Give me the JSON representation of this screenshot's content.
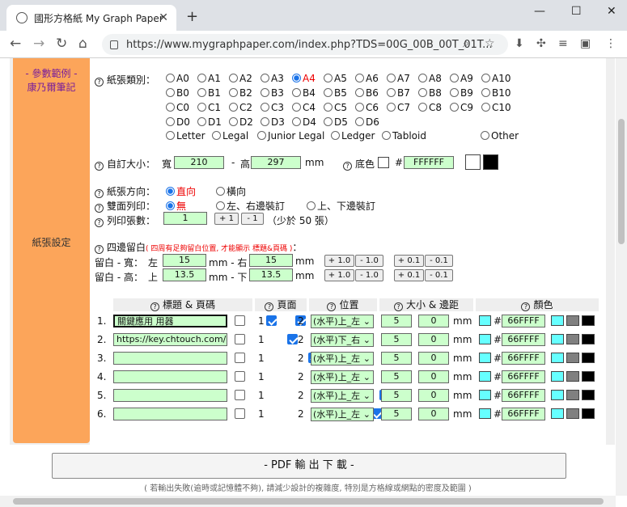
{
  "browser": {
    "tab_title": "國形方格紙 My Graph Paper",
    "url": "https://www.mygraphpaper.com/index.php?TDS=00G_00B_00T_01T...",
    "win_min": "—",
    "win_max": "☐",
    "win_close": "✕",
    "new_tab": "+",
    "tab_close": "✕",
    "back": "←",
    "forward": "→",
    "reload": "↻",
    "home": "⌂"
  },
  "sidebar": {
    "examples_label": "- 參數範例 -",
    "examples_link": "康乃爾筆記",
    "section_label": "紙張設定"
  },
  "paper_type": {
    "label": "紙張類別：",
    "row1": [
      "A0",
      "A1",
      "A2",
      "A3",
      "A4",
      "A5",
      "A6",
      "A7",
      "A8",
      "A9",
      "A10"
    ],
    "row2": [
      "B0",
      "B1",
      "B2",
      "B3",
      "B4",
      "B5",
      "B6",
      "B7",
      "B8",
      "B9",
      "B10"
    ],
    "row3": [
      "C0",
      "C1",
      "C2",
      "C3",
      "C4",
      "C5",
      "C6",
      "C7",
      "C8",
      "C9",
      "C10"
    ],
    "row4": [
      "D0",
      "D1",
      "D2",
      "D3",
      "D4",
      "D5",
      "D6"
    ],
    "row5": [
      "Letter",
      "Legal",
      "Junior Legal",
      "Ledger",
      "Tabloid"
    ],
    "other": "Other",
    "selected": "A4"
  },
  "custom_size": {
    "label": "自訂大小：",
    "width_label": "寬",
    "width_value": "210",
    "dash": "-",
    "height_label": "高",
    "height_value": "297",
    "unit": "mm",
    "bg_label": "底色",
    "hash": "#",
    "bg_value": "FFFFFF"
  },
  "orientation": {
    "label": "紙張方向：",
    "portrait": "直向",
    "landscape": "橫向"
  },
  "duplex": {
    "label": "雙面列印：",
    "none": "無",
    "lr": "左、右邊裝訂",
    "tb": "上、下邊裝訂"
  },
  "copies": {
    "label": "列印張數：",
    "value": "1",
    "plus": "+ 1",
    "minus": "- 1",
    "note": "（少於 50 張）"
  },
  "margins": {
    "label": "四邊留白",
    "note": "( 四周有足夠留白位置, 才能顯示 標題&頁碼 )",
    "colon": "：",
    "width_label": "留白 - 寬：",
    "left": "左",
    "left_value": "15",
    "mm_dash": "mm - 右",
    "right_value": "15",
    "unit": "mm",
    "height_label": "留白 - 高：",
    "top": "上",
    "top_value": "13.5",
    "mm_dash2": "mm - 下",
    "bottom_value": "13.5",
    "p10": "+ 1.0",
    "m10": "- 1.0",
    "p01": "+ 0.1",
    "m01": "- 0.1"
  },
  "header_table": {
    "col_title": "標題 & 頁碼",
    "col_page": "頁面",
    "col_pos": "位置",
    "col_size": "大小 & 邊距",
    "col_color": "顏色",
    "rows": [
      {
        "num": "1.",
        "text": "關鍵應用 用器",
        "pos": "(水平)上_左",
        "size": "5",
        "margin": "0",
        "color": "66FFFF"
      },
      {
        "num": "2.",
        "text": "https://key.chtouch.com/",
        "pos": "(水平)下_右",
        "size": "5",
        "margin": "0",
        "color": "66FFFF"
      },
      {
        "num": "3.",
        "text": "",
        "pos": "(水平)上_左",
        "size": "5",
        "margin": "0",
        "color": "66FFFF"
      },
      {
        "num": "4.",
        "text": "",
        "pos": "(水平)上_左",
        "size": "5",
        "margin": "0",
        "color": "66FFFF"
      },
      {
        "num": "5.",
        "text": "",
        "pos": "(水平)上_左",
        "size": "5",
        "margin": "0",
        "color": "66FFFF"
      },
      {
        "num": "6.",
        "text": "",
        "pos": "(水平)上_左",
        "size": "5",
        "margin": "0",
        "color": "66FFFF"
      }
    ],
    "page1": "1",
    "page2": "2",
    "mm": "mm",
    "hash": "#"
  },
  "pdf_button": "- PDF 輸 出 下 載 -",
  "footer_note": "( 若輸出失敗(逾時或記憶體不夠), 請減少設計的複雜度, 特別是方格線或網點的密度及範圍 )",
  "colors": {
    "sidebar": "#fca55a",
    "green_input": "#ccffcc",
    "cyan": "#66ffff",
    "accent": "#1a73e8"
  }
}
